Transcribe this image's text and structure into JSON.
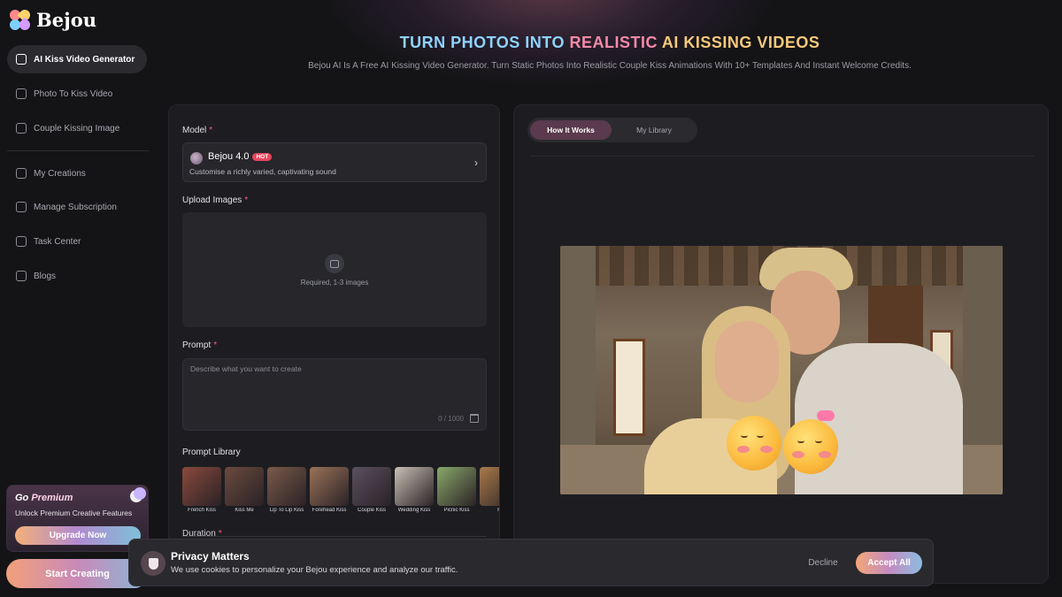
{
  "brand": {
    "name": "Bejou"
  },
  "sidebar": {
    "items": [
      {
        "label": "AI Kiss Video Generator",
        "icon": "sparkle-video-icon"
      },
      {
        "label": "Photo To Kiss Video",
        "icon": "photo-video-icon"
      },
      {
        "label": "Couple Kissing Image",
        "icon": "image-icon"
      },
      {
        "label": "My Creations",
        "icon": "folder-icon"
      },
      {
        "label": "Manage Subscription",
        "icon": "card-icon"
      },
      {
        "label": "Task Center",
        "icon": "gift-icon"
      },
      {
        "label": "Blogs",
        "icon": "doc-icon"
      }
    ],
    "premium": {
      "title_prefix": "Go",
      "title_highlight": "Premium",
      "subtitle": "Unlock Premium Creative Features",
      "button": "Upgrade Now"
    },
    "start_button": "Start Creating"
  },
  "header": {
    "title_part1": "TURN PHOTOS INTO",
    "title_part2": "REALISTIC",
    "title_part3": "AI KISSING VIDEOS",
    "subtitle": "Bejou AI Is A Free AI Kissing Video Generator. Turn Static Photos Into Realistic Couple Kiss Animations With 10+ Templates And Instant Welcome Credits."
  },
  "form": {
    "model_label": "Model",
    "model_name": "Bejou 4.0",
    "model_badge": "HOT",
    "model_desc": "Customise a richly varied, captivating sound",
    "upload_label": "Upload Images",
    "upload_hint": "Required, 1-3 images",
    "prompt_label": "Prompt",
    "prompt_placeholder": "Describe what you want to create",
    "prompt_counter": "0 / 1000",
    "library_label": "Prompt Library",
    "library": [
      {
        "label": "French Kiss",
        "color": "#8a4a3c"
      },
      {
        "label": "Kiss Me",
        "color": "#6b4a3e"
      },
      {
        "label": "Lip To Lip Kiss",
        "color": "#7a5a4a"
      },
      {
        "label": "Forehead Kiss",
        "color": "#9a7258"
      },
      {
        "label": "Couple Kiss",
        "color": "#5a5060"
      },
      {
        "label": "Wedding Kiss",
        "color": "#c8c0b4"
      },
      {
        "label": "Picnic Kiss",
        "color": "#8aa86a"
      },
      {
        "label": "F",
        "color": "#a87a4a"
      }
    ],
    "duration_label": "Duration"
  },
  "preview_tabs": [
    "How It Works",
    "My Library"
  ],
  "cookie": {
    "title": "Privacy Matters",
    "text": "We use cookies to personalize your Bejou experience and analyze our traffic.",
    "decline": "Decline",
    "accept": "Accept All"
  }
}
